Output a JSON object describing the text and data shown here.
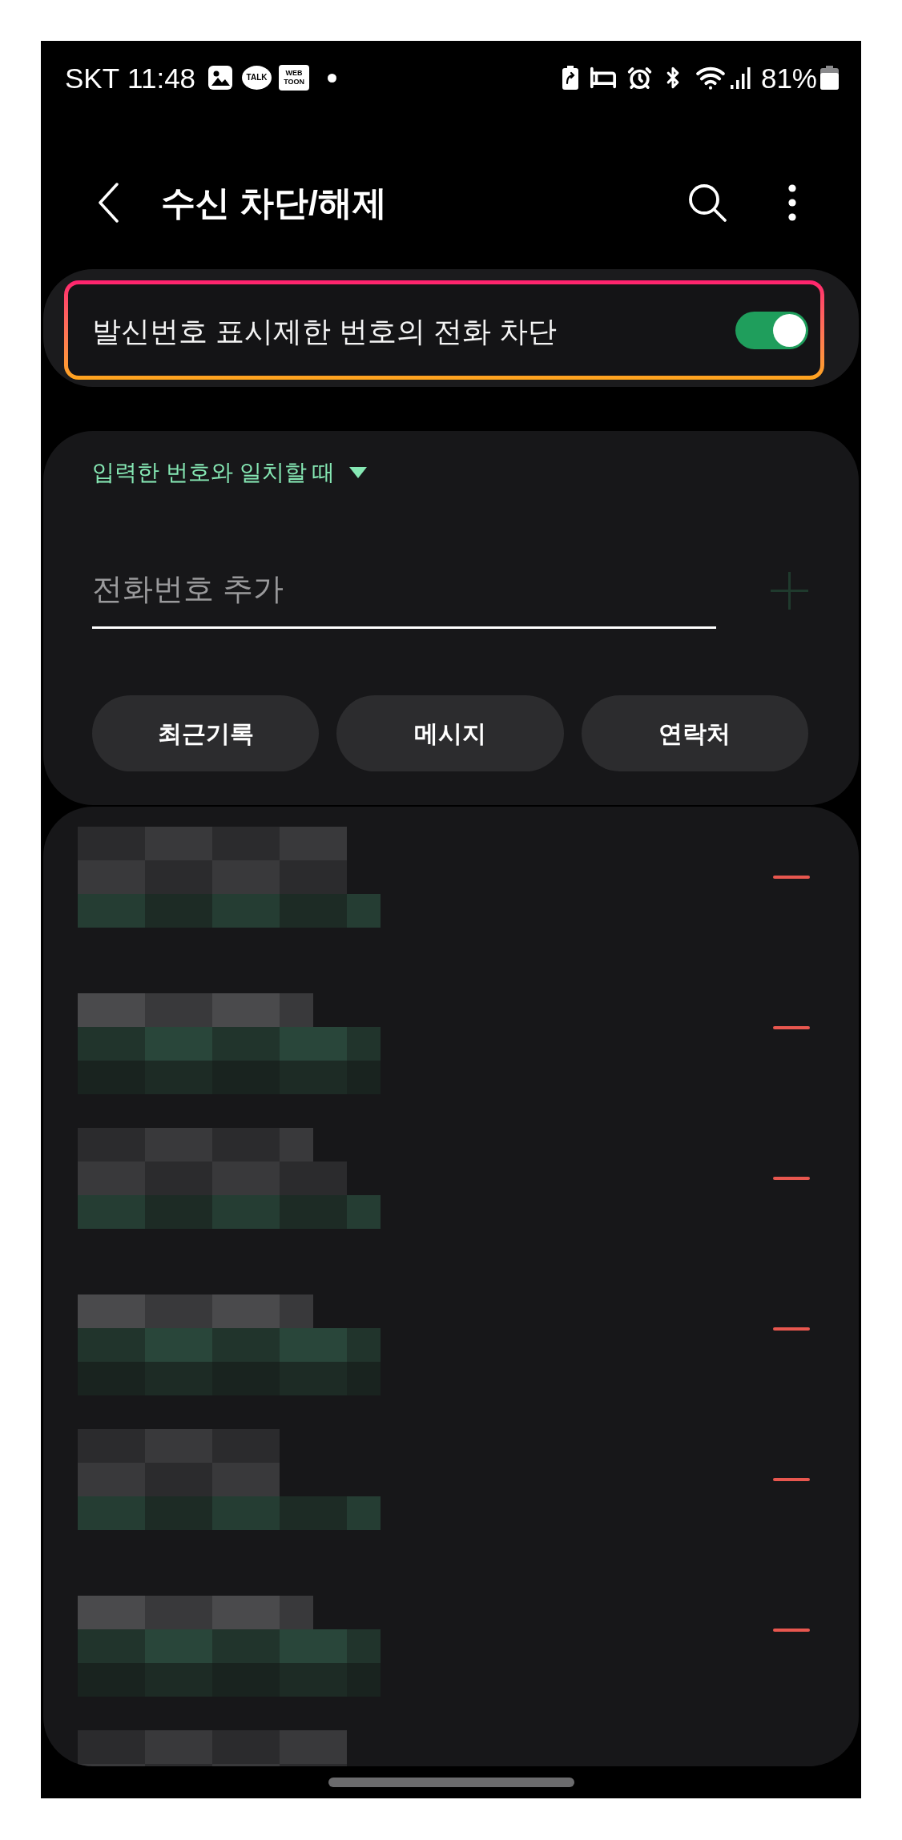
{
  "status_bar": {
    "carrier": "SKT",
    "time": "11:48",
    "chat_logo": "TALK",
    "comic_logo": [
      "WEB",
      "TOON"
    ],
    "battery": "81%"
  },
  "header": {
    "title": "수신 차단/해제"
  },
  "hidden_number_block": {
    "label": "발신번호 표시제한 번호의 전화 차단",
    "on": true,
    "highlighted": true
  },
  "add_number": {
    "match_rule": "입력한 번호와 일치할 때",
    "placeholder": "전화번호 추가",
    "add_disabled": true,
    "sources": [
      "최근기록",
      "메시지",
      "연락처"
    ]
  },
  "blocked_numbers": [
    {
      "kind": "redacted"
    },
    {
      "kind": "redacted"
    },
    {
      "kind": "redacted"
    },
    {
      "kind": "redacted"
    },
    {
      "kind": "redacted"
    },
    {
      "kind": "redacted"
    },
    {
      "kind": "redacted_partial"
    }
  ]
}
